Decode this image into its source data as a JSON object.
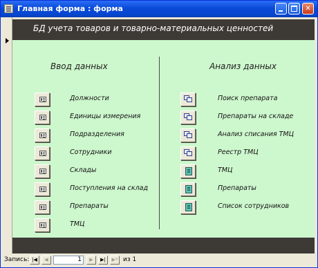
{
  "window": {
    "title": "Главная форма : форма"
  },
  "header": {
    "title": "БД учета товаров и товарно-материальных ценностей"
  },
  "left_section": {
    "title": "Ввод данных",
    "items": [
      {
        "label": "Должности",
        "icon": "form-icon"
      },
      {
        "label": "Единицы измерения",
        "icon": "form-icon"
      },
      {
        "label": "Подразделения",
        "icon": "form-icon"
      },
      {
        "label": "Сотрудники",
        "icon": "form-icon"
      },
      {
        "label": "Склады",
        "icon": "form-icon"
      },
      {
        "label": "Поступления на склад",
        "icon": "form-icon"
      },
      {
        "label": "Препараты",
        "icon": "form-icon"
      },
      {
        "label": "ТМЦ",
        "icon": "form-icon"
      }
    ]
  },
  "right_section": {
    "title": "Анализ данных",
    "items": [
      {
        "label": "Поиск препарата",
        "icon": "query-icon"
      },
      {
        "label": "Препараты на складе",
        "icon": "query-icon"
      },
      {
        "label": "Анализ списания ТМЦ",
        "icon": "query-icon"
      },
      {
        "label": "Реестр ТМЦ",
        "icon": "query-icon"
      },
      {
        "label": "ТМЦ",
        "icon": "report-icon"
      },
      {
        "label": "Препараты",
        "icon": "report-icon"
      },
      {
        "label": "Список сотрудников",
        "icon": "report-icon"
      }
    ]
  },
  "record_nav": {
    "label": "Запись:",
    "current": "1",
    "of_label": "из",
    "total": "1",
    "first_glyph": "|◀",
    "prev_glyph": "◀",
    "next_glyph": "▶",
    "last_glyph": "▶|",
    "new_glyph": "▶*"
  },
  "titlebar_buttons": {
    "close_glyph": "✕"
  },
  "colors": {
    "detail_bg": "#cdf7cd",
    "header_bg": "#3d3a36",
    "titlebar": "#0a4ad8"
  }
}
